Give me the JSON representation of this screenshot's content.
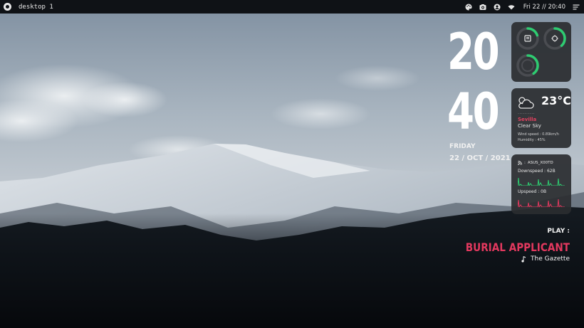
{
  "topbar": {
    "workspace": "desktop 1",
    "datetime": "Fri 22 // 20:40",
    "icons": [
      "logo-icon",
      "palette-icon",
      "camera-icon",
      "user-icon",
      "wifi-icon",
      "menu-icon"
    ]
  },
  "clock": {
    "hours": "20",
    "minutes": "40",
    "day": "FRIDAY",
    "date": "22 / OCT / 2021"
  },
  "system": {
    "rings": [
      {
        "name": "memory",
        "percent": 20,
        "icon": "memory-icon"
      },
      {
        "name": "cpu",
        "percent": 38,
        "icon": "cpu-icon"
      },
      {
        "name": "disk",
        "percent": 40,
        "icon": "disk-icon"
      }
    ],
    "accent": "#2ecc71"
  },
  "weather": {
    "temperature": "23°C",
    "dots": "··········",
    "city": "Sevilla",
    "description": "Clear Sky",
    "wind": "Wind speed : 0.89km/h",
    "humidity": "Humidity : 45%",
    "icon": "cloud-icon"
  },
  "network": {
    "ssid": "ASUS_X00TD",
    "downspeed": "Downspeed : 62B",
    "upspeed": "Upspeed : 0B",
    "down_color": "#2ecc71",
    "up_color": "#e2385e"
  },
  "music": {
    "label": "PLAY :",
    "title": "BURIAL APPLICANT",
    "artist": "The Gazette",
    "icon": "music-note-icon"
  },
  "colors": {
    "accent_pink": "#e2385e",
    "accent_green": "#2ecc71",
    "card": "#2a2c30",
    "bar": "#0f1216"
  }
}
